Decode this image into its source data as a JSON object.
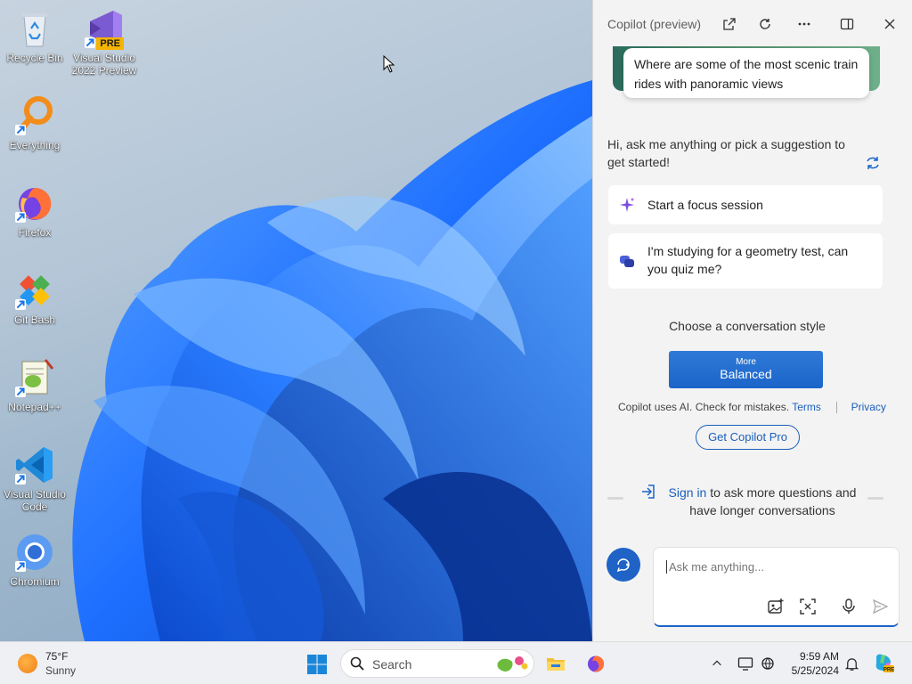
{
  "desktop": {
    "icons": [
      {
        "label": "Recycle Bin",
        "icon": "recycle-bin-icon"
      },
      {
        "label": "Visual Studio 2022 Preview",
        "icon": "visual-studio-preview-icon",
        "badge": "PRE"
      },
      {
        "label": "Everything",
        "icon": "everything-search-icon"
      },
      {
        "label": "Firefox",
        "icon": "firefox-icon"
      },
      {
        "label": "Git Bash",
        "icon": "git-bash-icon"
      },
      {
        "label": "Notepad++",
        "icon": "notepad-plus-plus-icon"
      },
      {
        "label": "Visual Studio Code",
        "icon": "vscode-icon"
      },
      {
        "label": "Chromium",
        "icon": "chromium-icon"
      }
    ]
  },
  "copilot": {
    "title": "Copilot (preview)",
    "header_icons": [
      "open-external-icon",
      "refresh-icon",
      "more-icon",
      "sidebar-toggle-icon",
      "close-icon"
    ],
    "top_suggestion": "Where are some of the most scenic train rides with panoramic views",
    "greeting": "Hi, ask me anything or pick a suggestion to get started!",
    "suggestions": [
      {
        "text": "Start a focus session",
        "icon": "sparkle-icon"
      },
      {
        "text": "I'm studying for a geometry test, can you quiz me?",
        "icon": "chat-bubbles-icon"
      }
    ],
    "style_title": "Choose a conversation style",
    "style_button": {
      "more": "More",
      "label": "Balanced"
    },
    "disclaimer": "Copilot uses AI. Check for mistakes.",
    "terms": "Terms",
    "privacy": "Privacy",
    "pro_button": "Get Copilot Pro",
    "signin_link": "Sign in",
    "signin_rest": "to ask more questions and have longer conversations",
    "input_placeholder": "Ask me anything...",
    "input_icons": [
      "add-image-icon",
      "screenshot-icon",
      "microphone-icon",
      "send-icon"
    ],
    "accent_color": "#1b64c9"
  },
  "taskbar": {
    "weather_temp": "75°F",
    "weather_cond": "Sunny",
    "search_label": "Search",
    "apps": [
      "start-icon",
      "file-explorer-icon",
      "firefox-icon"
    ],
    "tray": [
      "chevron-up-icon",
      "display-icon",
      "network-icon",
      "notification-bell-icon",
      "copilot-icon"
    ],
    "time": "9:59 AM",
    "date": "5/25/2024"
  }
}
